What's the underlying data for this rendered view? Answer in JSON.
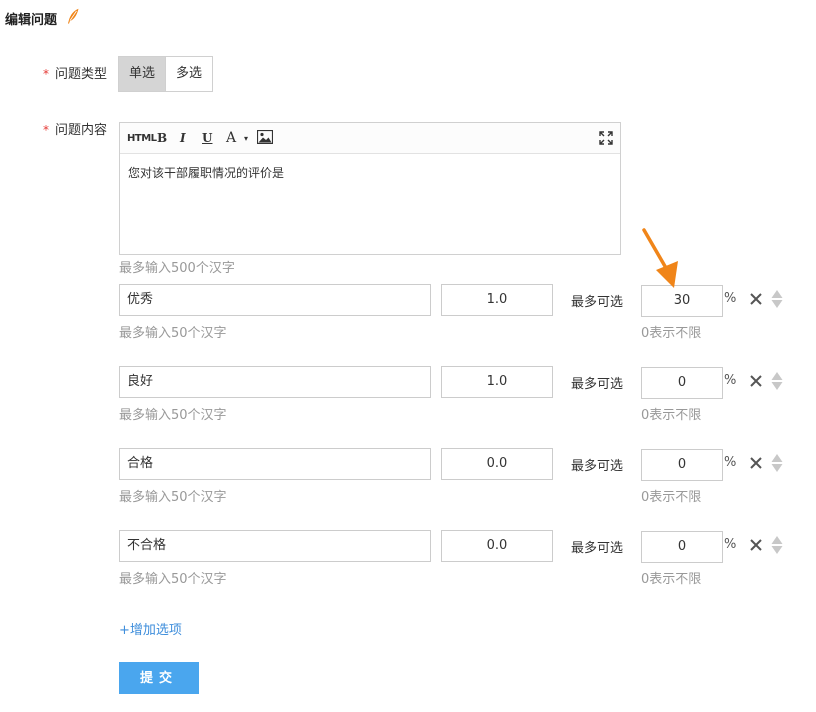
{
  "page": {
    "title": "编辑问题",
    "title_icon": "feather-pen-icon",
    "accent_color": "#f08519"
  },
  "question_type": {
    "required_mark": "*",
    "label": "问题类型",
    "options": [
      "单选",
      "多选"
    ],
    "selected": "单选"
  },
  "question_content": {
    "required_mark": "*",
    "label": "问题内容",
    "toolbar": {
      "html_label": "HTML",
      "bold_label": "B",
      "italic_label": "I",
      "underline_label": "U",
      "font_color_label": "A",
      "caret": "▾",
      "image_icon": "image-icon",
      "fullscreen_icon": "fullscreen-icon"
    },
    "value": "您对该干部履职情况的评价是",
    "hint": "最多输入500个汉字"
  },
  "options": [
    {
      "name": "优秀",
      "score": "1.0",
      "max_label": "最多可选",
      "max_value": "30",
      "unit": "%",
      "name_hint": "最多输入50个汉字",
      "max_hint": "0表示不限"
    },
    {
      "name": "良好",
      "score": "1.0",
      "max_label": "最多可选",
      "max_value": "0",
      "unit": "%",
      "name_hint": "最多输入50个汉字",
      "max_hint": "0表示不限"
    },
    {
      "name": "合格",
      "score": "0.0",
      "max_label": "最多可选",
      "max_value": "0",
      "unit": "%",
      "name_hint": "最多输入50个汉字",
      "max_hint": "0表示不限"
    },
    {
      "name": "不合格",
      "score": "0.0",
      "max_label": "最多可选",
      "max_value": "0",
      "unit": "%",
      "name_hint": "最多输入50个汉字",
      "max_hint": "0表示不限"
    }
  ],
  "add_option_label": "+增加选项",
  "submit_label": "提交",
  "colors": {
    "primary": "#4aa6ee",
    "link": "#3d8ddb",
    "required": "#e53935",
    "arrow": "#f08519",
    "hint": "#999999"
  }
}
